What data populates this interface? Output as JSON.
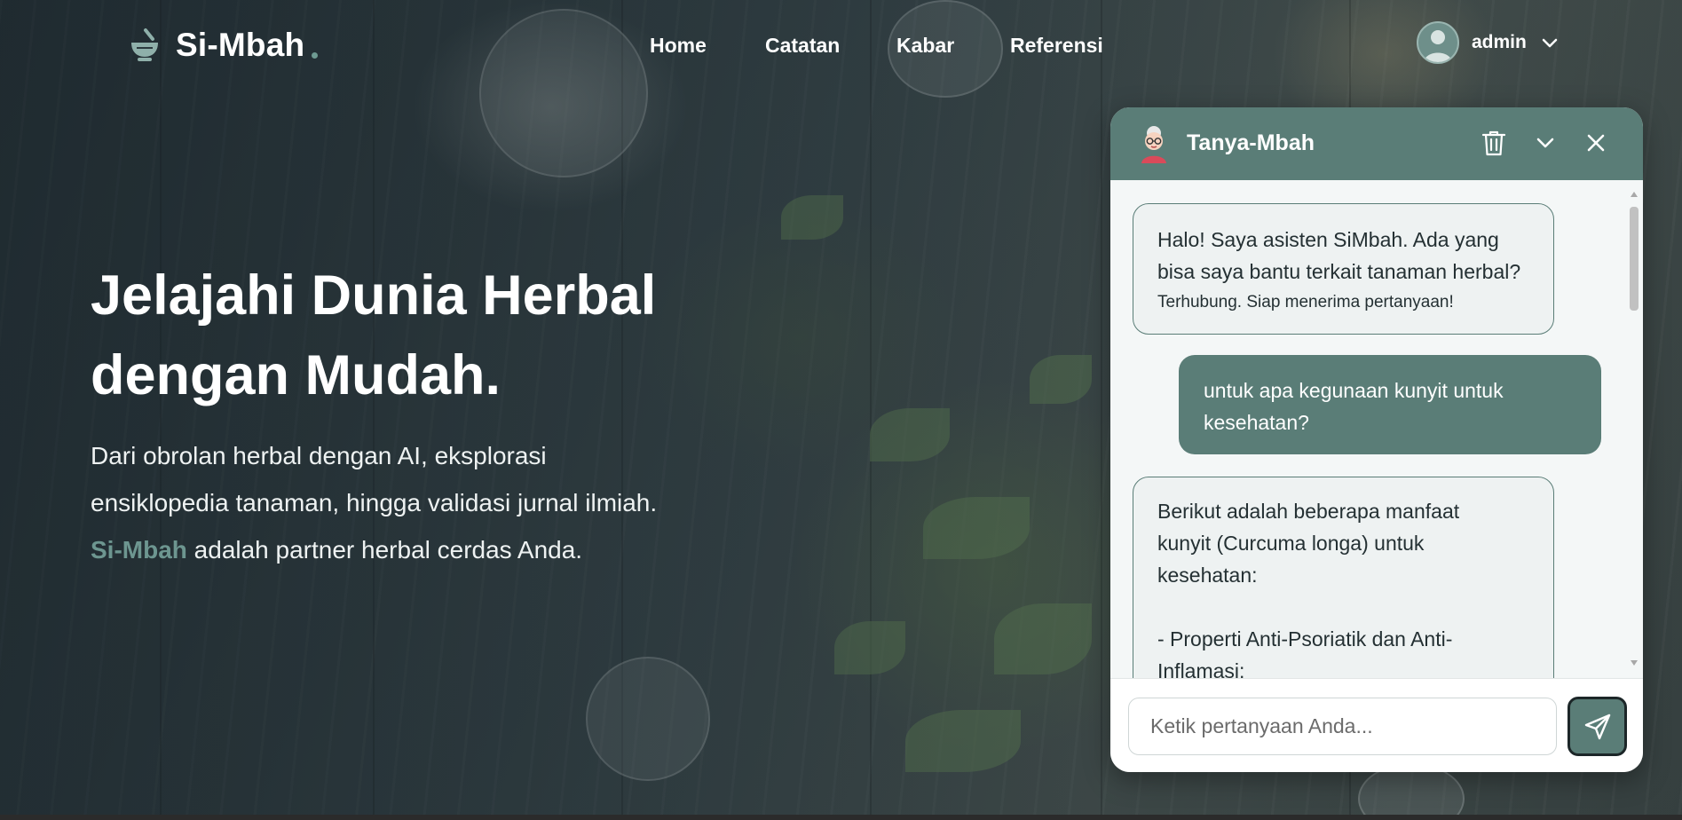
{
  "brand": {
    "name": "Si-Mbah"
  },
  "nav": {
    "links": [
      "Home",
      "Catatan",
      "Kabar",
      "Referensi"
    ],
    "user": {
      "name": "admin"
    }
  },
  "hero": {
    "headline_line1": "Jelajahi Dunia Herbal",
    "headline_line2": "dengan Mudah.",
    "sub_line1": "Dari obrolan herbal dengan AI, eksplorasi",
    "sub_line2": "ensiklopedia tanaman, hingga validasi jurnal ilmiah.",
    "sub_accent": "Si-Mbah",
    "sub_line3_rest": " adalah partner herbal cerdas Anda."
  },
  "chat": {
    "title": "Tanya-Mbah",
    "messages": [
      {
        "role": "bot",
        "line1": "Halo! Saya asisten SiMbah. Ada yang",
        "line2": "bisa saya bantu terkait tanaman herbal?",
        "status": "Terhubung. Siap menerima pertanyaan!"
      },
      {
        "role": "user",
        "line1": "untuk apa kegunaan kunyit untuk",
        "line2": "kesehatan?"
      },
      {
        "role": "bot",
        "line1": "Berikut adalah beberapa manfaat",
        "line2": "kunyit (Curcuma longa) untuk",
        "line3": "kesehatan:",
        "line4": "- Properti Anti-Psoriatik dan Anti-",
        "line5": "Inflamasi:"
      }
    ],
    "input_placeholder": "Ketik pertanyaan Anda..."
  },
  "colors": {
    "accent": "#5a7d77",
    "accent_text": "#6d9690",
    "bubble_bg": "#eef2f2"
  },
  "icons": {
    "brand": "mortar-pestle-icon",
    "delete": "trash-icon",
    "minimize": "chevron-down-icon",
    "close": "close-icon",
    "send": "send-icon"
  }
}
